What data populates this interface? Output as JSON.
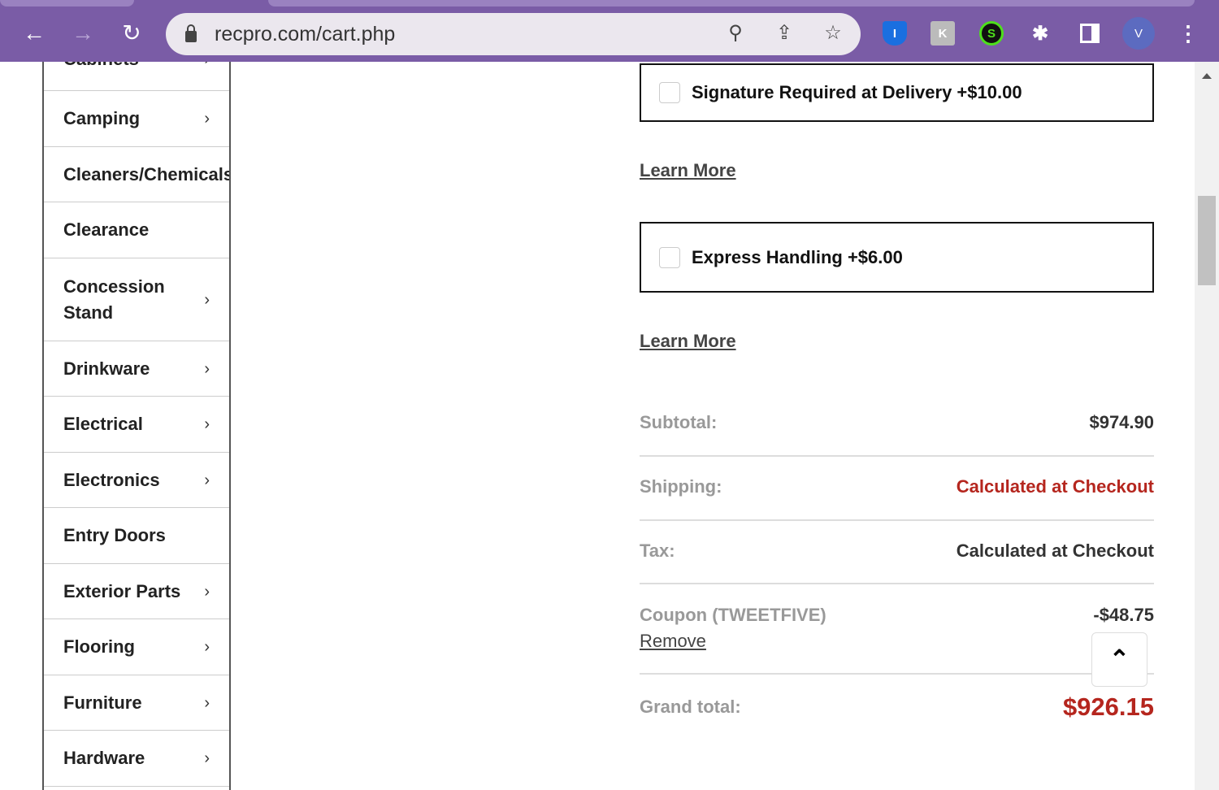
{
  "browser": {
    "url": "recpro.com/cart.php",
    "profile_initial": "V"
  },
  "sidebar": {
    "items": [
      {
        "label": "Cabinets",
        "chevron": true
      },
      {
        "label": "Camping",
        "chevron": true
      },
      {
        "label": "Cleaners/Chemicals",
        "chevron": false
      },
      {
        "label": "Clearance",
        "chevron": false
      },
      {
        "label": "Concession Stand",
        "chevron": true
      },
      {
        "label": "Drinkware",
        "chevron": true
      },
      {
        "label": "Electrical",
        "chevron": true
      },
      {
        "label": "Electronics",
        "chevron": true
      },
      {
        "label": "Entry Doors",
        "chevron": false
      },
      {
        "label": "Exterior Parts",
        "chevron": true
      },
      {
        "label": "Flooring",
        "chevron": true
      },
      {
        "label": "Furniture",
        "chevron": true
      },
      {
        "label": "Hardware",
        "chevron": true
      }
    ]
  },
  "options": [
    {
      "label": "Signature Required at Delivery +$10.00",
      "learn_more": "Learn More"
    },
    {
      "label": "Express Handling +$6.00",
      "learn_more": "Learn More"
    }
  ],
  "summary": {
    "subtotal_label": "Subtotal:",
    "subtotal": "$974.90",
    "shipping_label": "Shipping:",
    "shipping": "Calculated at Checkout",
    "tax_label": "Tax:",
    "tax": "Calculated at Checkout",
    "coupon_label": "Coupon (TWEETFIVE)",
    "coupon": "-$48.75",
    "remove": "Remove",
    "grand_label": "Grand total:",
    "grand": "$926.15"
  },
  "colors": {
    "accent": "#b5261e",
    "browser": "#7a5ca6"
  }
}
